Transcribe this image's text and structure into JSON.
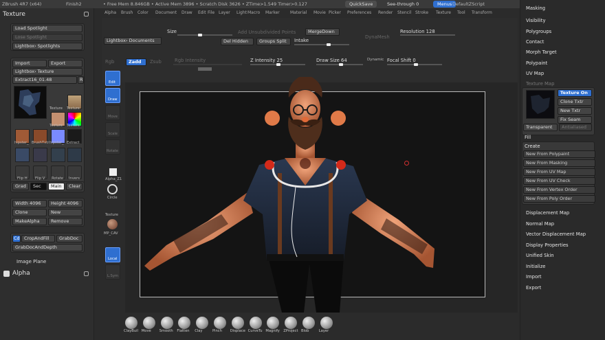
{
  "titlebar": {
    "app": "ZBrush 4R7 (x64)",
    "file": "Finish2",
    "mem": "• Free Mem 8.846GB • Active Mem 3896 • Scratch Disk 3626 • ZTime>1.549 Timer>0.127",
    "quicksave": "QuickSave",
    "seethrough": "See-through 0",
    "menus": "Menus",
    "script": "DefaultZScript"
  },
  "menubar": [
    "Alpha",
    "Brush",
    "Color",
    "Document",
    "Draw",
    "Edit",
    "File",
    "Layer",
    "Light",
    "Macro",
    "Marker",
    "Material",
    "Movie",
    "Picker",
    "Preferences",
    "Render",
    "Stencil",
    "Stroke",
    "Texture",
    "Tool",
    "Transform",
    "Zplugin",
    "Zscript"
  ],
  "left": {
    "title": "Texture",
    "load_spotlight": "Load Spotlight",
    "lose_spotlight": "Lose Spotlight",
    "lightbox_spotlights": "Lightbox› Spotlights",
    "import": "Import",
    "export": "Export",
    "lightbox_texture": "Lightbox› Texture",
    "texname": "Extract16_01.48",
    "texval": "48",
    "r": "R",
    "thumbs": [
      "Texture",
      "Texture",
      "Texture",
      "Texture",
      "Extract16_01",
      "BrushTxtr",
      "hipster_",
      "hipster_",
      "BrushTx",
      "Extract"
    ],
    "flip_h": "Flip H",
    "flip_v": "Flip V",
    "rotate": "Rotate",
    "invers": "Invers",
    "grad": "Grad",
    "sec": "Sec",
    "main": "Main",
    "clear": "Clear",
    "width": "Width 4096",
    "height": "Height 4096",
    "clone": "Clone",
    "new": "New",
    "make_alpha": "MakeAlpha",
    "remove": "Remove",
    "cd": "Cd",
    "crop_fill": "CropAndFill",
    "grab_doc": "GrabDoc",
    "grab_doc_depth": "GrabDocAndDepth",
    "image_plane": "Image Plane",
    "alpha": "Alpha"
  },
  "top": {
    "size": "Size",
    "add_unsub": "Add Unsubdivided Points",
    "mergedown": "MergeDown",
    "resolution": "Resolution 128",
    "lightbox_docs": "Lightbox› Documents",
    "del_hidden": "Del Hidden",
    "groups_split": "Groups Split",
    "intake": "Intake",
    "dynamesh": "DynaMesh",
    "rgb": "Rgb",
    "zadd": "Zadd",
    "zsub": "Zsub",
    "rgb_intensity": "Rgb Intensity",
    "z_intensity": "Z Intensity 25",
    "draw_size": "Draw Size 64",
    "dynamic": "Dynamic",
    "focal_shift": "Focal Shift 0"
  },
  "tools": {
    "edit": "Edit",
    "draw": "Draw",
    "move": "Move",
    "scale": "Scale",
    "rotate": "Rotate",
    "alpha": "Alpha_Z1",
    "circle": "Circle",
    "texture": "Texture",
    "mat": "MP_CAV",
    "local": "Local",
    "l_sym": "L.Sym"
  },
  "right": {
    "items_top": [
      "Masking",
      "Visibility",
      "Polygroups",
      "Contact",
      "Morph Target",
      "Polypaint",
      "UV Map",
      "Texture Map"
    ],
    "texture_on": "Texture On",
    "clone_txtr": "Clone Txtr",
    "new_txtr": "New Txtr",
    "fix_seam": "Fix Seam",
    "transparent": "Transparent",
    "antialiased": "Antialiased",
    "fill": "Fill",
    "create": "Create",
    "create_btns": [
      "New From Polypaint",
      "New From Masking",
      "New From UV Map",
      "New From UV Check",
      "New From Vertex Order",
      "New From Poly Order"
    ],
    "items_bottom": [
      "Displacement Map",
      "Normal Map",
      "Vector Displacement Map",
      "Display Properties",
      "Unified Skin",
      "Initialize",
      "Import",
      "Export"
    ]
  },
  "brushes": [
    "ClayBuil",
    "Move",
    "Smooth",
    "Flatten",
    "Clay",
    "Pinch",
    "Displace",
    "CurveTu",
    "Magnify",
    "ZProject",
    "Blob",
    "Layer"
  ],
  "colors": {
    "accent": "#2f6fd0",
    "bg": "#2b2b2b",
    "viewport": "#141414"
  }
}
